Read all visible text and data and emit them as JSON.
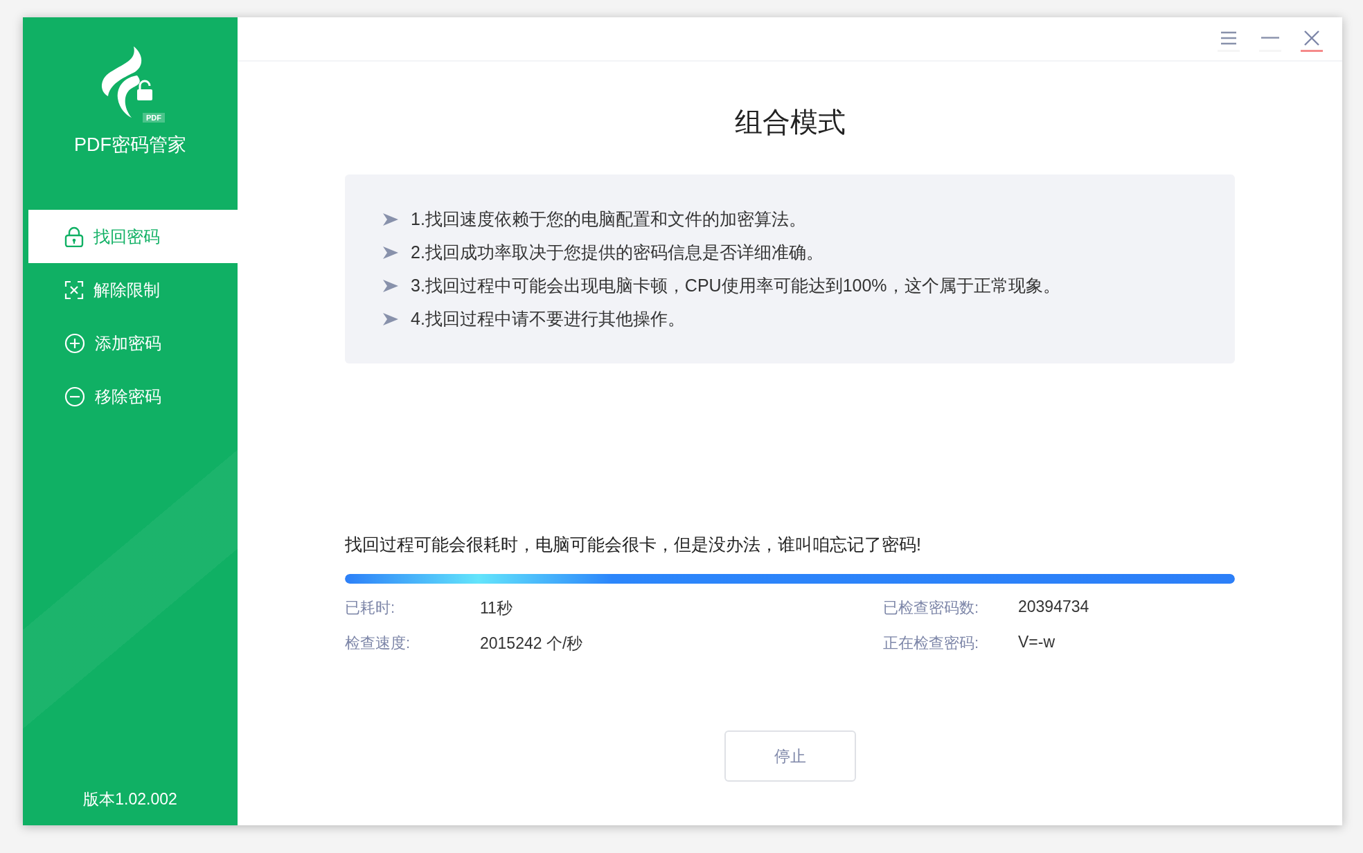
{
  "app": {
    "name": "PDF密码管家",
    "logo_badge": "PDF",
    "version": "版本1.02.002"
  },
  "sidebar": {
    "items": [
      {
        "label": "找回密码",
        "selected": true
      },
      {
        "label": "解除限制",
        "selected": false
      },
      {
        "label": "添加密码",
        "selected": false
      },
      {
        "label": "移除密码",
        "selected": false
      }
    ]
  },
  "title": "组合模式",
  "notes": [
    "1.找回速度依赖于您的电脑配置和文件的加密算法。",
    "2.找回成功率取决于您提供的密码信息是否详细准确。",
    "3.找回过程中可能会出现电脑卡顿，CPU使用率可能达到100%，这个属于正常现象。",
    "4.找回过程中请不要进行其他操作。"
  ],
  "progress": {
    "message": "找回过程可能会很耗时，电脑可能会很卡，但是没办法，谁叫咱忘记了密码!",
    "level": 1
  },
  "stats": [
    {
      "label": "已耗时:",
      "value": "11秒"
    },
    {
      "label": "已检查密码数:",
      "value": "20394734"
    },
    {
      "label": "检查速度:",
      "value": "2015242 个/秒"
    },
    {
      "label": "正在检查密码:",
      "value": "V=-w"
    }
  ],
  "stop_button": "停止"
}
